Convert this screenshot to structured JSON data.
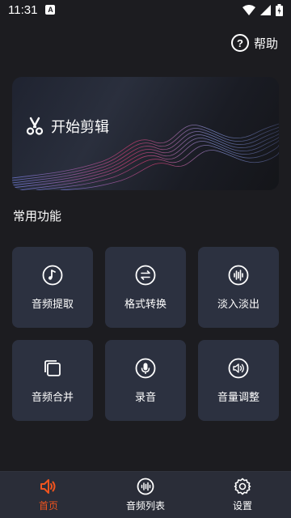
{
  "status": {
    "time": "11:31",
    "notif": "A"
  },
  "header": {
    "help_label": "帮助",
    "help_icon": "help-circle-icon"
  },
  "banner": {
    "label": "开始剪辑",
    "icon": "scissors-icon"
  },
  "section": {
    "title": "常用功能"
  },
  "features": [
    {
      "label": "音频提取",
      "icon": "music-note-icon"
    },
    {
      "label": "格式转换",
      "icon": "convert-arrows-icon"
    },
    {
      "label": "淡入淡出",
      "icon": "waveform-icon"
    },
    {
      "label": "音频合并",
      "icon": "merge-pages-icon"
    },
    {
      "label": "录音",
      "icon": "microphone-icon"
    },
    {
      "label": "音量调整",
      "icon": "volume-icon"
    }
  ],
  "tabs": [
    {
      "label": "首页",
      "icon": "speaker-icon",
      "active": true
    },
    {
      "label": "音频列表",
      "icon": "audio-list-icon",
      "active": false
    },
    {
      "label": "设置",
      "icon": "gear-icon",
      "active": false
    }
  ],
  "colors": {
    "accent": "#f0541e",
    "background": "#1c1c20",
    "card": "#2c3140",
    "tabbar": "#2a2d38"
  }
}
